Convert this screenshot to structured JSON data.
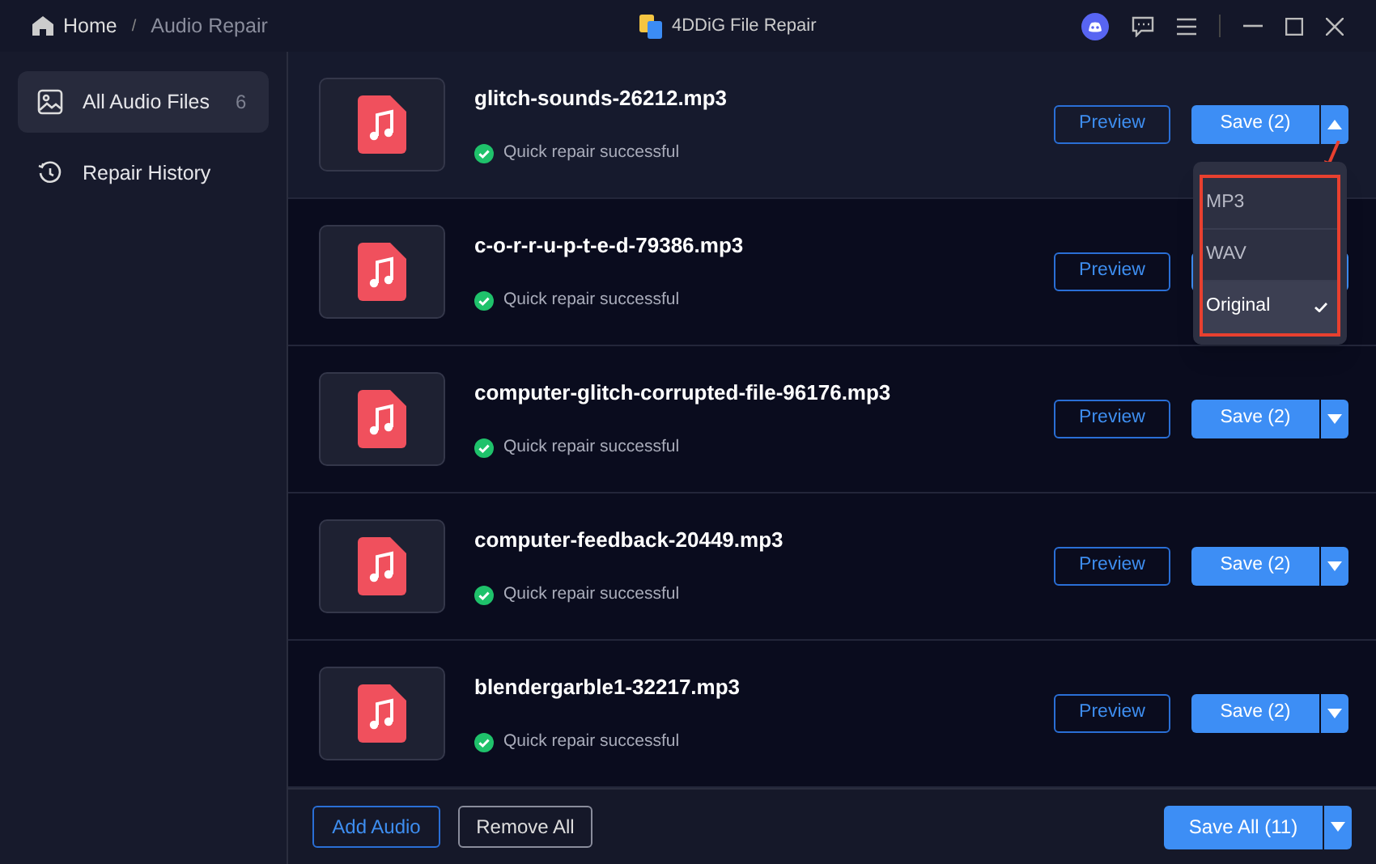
{
  "titlebar": {
    "breadcrumb": [
      "Home",
      "/",
      "Audio Repair"
    ],
    "title": "4DDiG File Repair"
  },
  "sidebar": {
    "items": [
      {
        "label": "All Audio Files",
        "count": "6",
        "selected": true,
        "kind": "files"
      },
      {
        "label": "Repair History",
        "selected": false,
        "kind": "history"
      }
    ]
  },
  "files": [
    {
      "name": "glitch-sounds-26212.mp3",
      "status": "Quick repair successful",
      "preview": "Preview",
      "save": "Save (2)",
      "selected": true,
      "expanded": true
    },
    {
      "name": "c-o-r-r-u-p-t-e-d-79386.mp3",
      "status": "Quick repair successful",
      "preview": "Preview",
      "selected": false
    },
    {
      "name": "computer-glitch-corrupted-file-96176.mp3",
      "status": "Quick repair successful",
      "preview": "Preview",
      "save": "Save (2)",
      "selected": false,
      "expanded": false
    },
    {
      "name": "computer-feedback-20449.mp3",
      "status": "Quick repair successful",
      "preview": "Preview",
      "save": "Save (2)",
      "selected": false,
      "expanded": false
    },
    {
      "name": "blendergarble1-32217.mp3",
      "status": "Quick repair successful",
      "preview": "Preview",
      "save": "Save (2)",
      "selected": false,
      "expanded": false
    }
  ],
  "save_menu": {
    "options": [
      {
        "label": "MP3",
        "selected": false
      },
      {
        "label": "WAV",
        "selected": false
      },
      {
        "label": "Original",
        "selected": true
      }
    ]
  },
  "footer": {
    "add": "Add Audio",
    "remove": "Remove All",
    "save_all": "Save All (11)"
  }
}
